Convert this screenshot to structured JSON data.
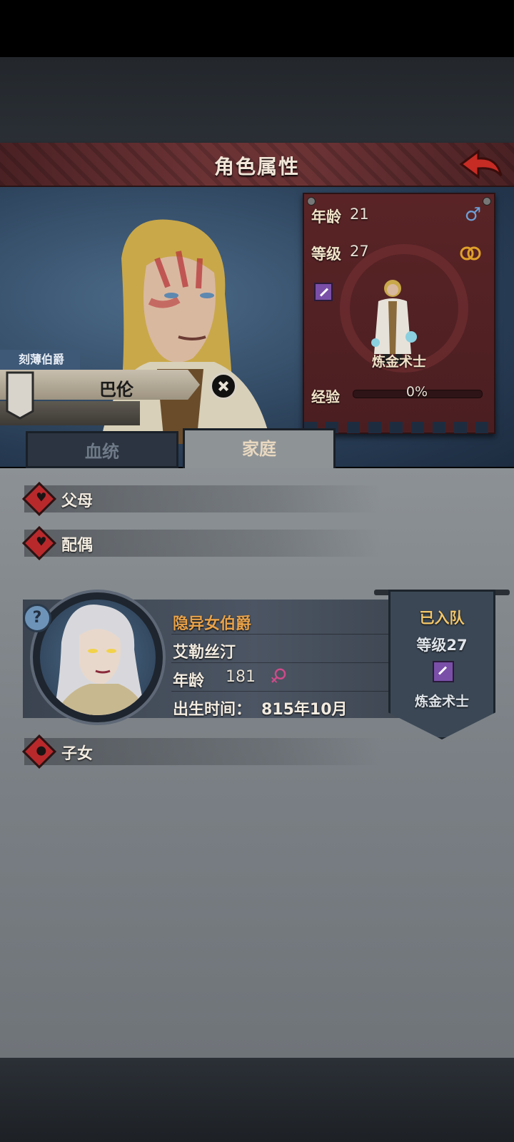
{
  "header": {
    "title": "角色属性"
  },
  "character": {
    "title": "刻薄伯爵",
    "name": "巴伦",
    "age_label": "年龄",
    "age": "21",
    "level_label": "等级",
    "level": "27",
    "class_name": "炼金术士",
    "exp_label": "经验",
    "exp_percent": "0%",
    "exp_progress": 0,
    "gender": "male"
  },
  "tabs": [
    {
      "label": "血统",
      "active": false
    },
    {
      "label": "家庭",
      "active": true
    }
  ],
  "family": {
    "parents_label": "父母",
    "spouse_label": "配偶",
    "children_label": "子女",
    "spouse": {
      "title": "隐异女伯爵",
      "name": "艾勒丝汀",
      "age_label": "年龄",
      "age": "181",
      "gender": "female",
      "birth_label": "出生时间：",
      "birth_value": "815年10月",
      "status": "已入队",
      "level_text": "等级27",
      "class_name": "炼金术士"
    }
  },
  "colors": {
    "title_bar": "#6c3335",
    "gold_text": "#e8a24a",
    "highlight_text": "#f2c66a",
    "heart_red": "#b8292c"
  }
}
